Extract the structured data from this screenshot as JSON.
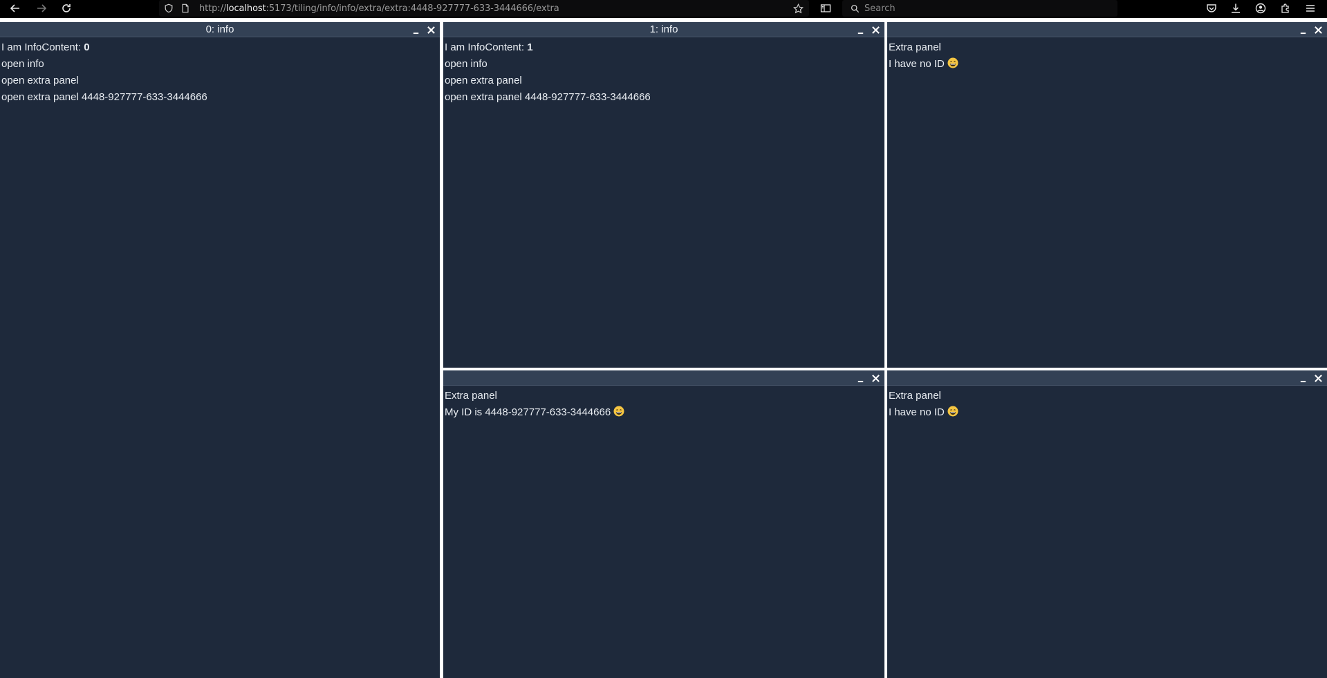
{
  "browser": {
    "url_host": "localhost",
    "url_prefix": "http://",
    "url_rest": ":5173/tiling/info/info/extra/extra:4448-927777-633-3444666/extra",
    "search_placeholder": "Search"
  },
  "panels": {
    "p0": {
      "title": "0: info",
      "intro": "I am InfoContent: ",
      "index": "0",
      "links": [
        "open info",
        "open extra panel",
        "open extra panel 4448-927777-633-3444666"
      ]
    },
    "p1": {
      "title": "1: info",
      "intro": "I am InfoContent: ",
      "index": "1",
      "links": [
        "open info",
        "open extra panel",
        "open extra panel 4448-927777-633-3444666"
      ]
    },
    "p2": {
      "title": "",
      "heading": "Extra panel",
      "text": "I have no ID"
    },
    "p3": {
      "title": "",
      "heading": "Extra panel",
      "text": "My ID is 4448-927777-633-3444666"
    },
    "p4": {
      "title": "",
      "heading": "Extra panel",
      "text": "I have no ID"
    }
  },
  "colors": {
    "panel_bg": "#1e293b",
    "header_bg": "#334155",
    "emoji": "#f5c542"
  },
  "icons": {
    "back": "arrow-left-icon",
    "forward": "arrow-right-icon",
    "reload": "reload-icon",
    "shield": "shield-icon",
    "page": "page-icon",
    "star": "star-icon",
    "sidebar": "sidebar-icon",
    "search": "search-icon",
    "pocket": "pocket-icon",
    "download": "download-icon",
    "account": "account-icon",
    "extensions": "extensions-icon",
    "menu": "menu-icon",
    "minimize": "minimize-icon",
    "close": "close-icon",
    "emoji": "grinning-face-icon"
  }
}
